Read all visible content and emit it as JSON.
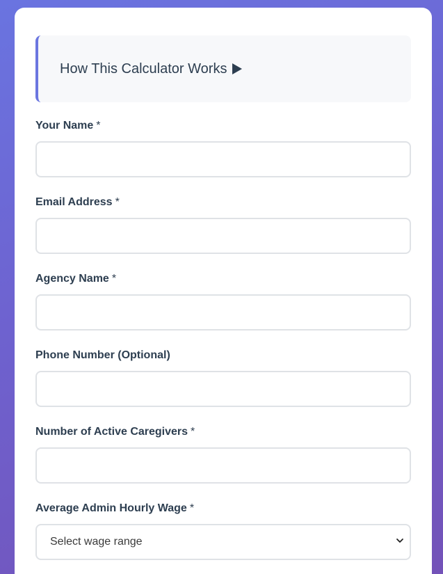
{
  "info_box": {
    "title": "How This Calculator Works"
  },
  "form": {
    "required_marker": "*",
    "fields": [
      {
        "label": "Your Name",
        "required": true,
        "value": ""
      },
      {
        "label": "Email Address",
        "required": true,
        "value": ""
      },
      {
        "label": "Agency Name",
        "required": true,
        "value": ""
      },
      {
        "label": "Phone Number (Optional)",
        "required": false,
        "value": ""
      },
      {
        "label": "Number of Active Caregivers",
        "required": true,
        "value": ""
      }
    ],
    "wage_select": {
      "label": "Average Admin Hourly Wage",
      "selected": "Select wage range"
    }
  },
  "colors": {
    "accent": "#6b76e0",
    "text": "#2d3e50",
    "input_border": "#dfe2e6"
  },
  "icons": {
    "expand": "play-icon",
    "dropdown": "chevron-down-icon"
  }
}
